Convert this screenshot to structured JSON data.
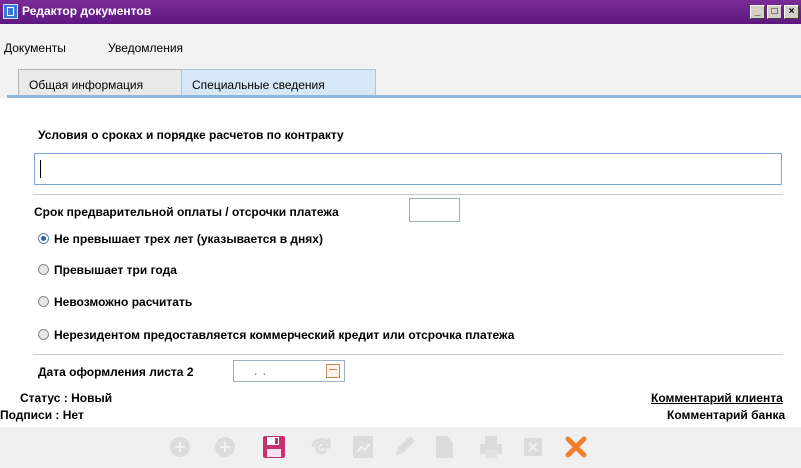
{
  "window": {
    "title": "Редактор документов"
  },
  "menu": {
    "items": [
      "Документы",
      "Уведомления"
    ]
  },
  "tabs": [
    "Общая информация",
    "Специальные сведения"
  ],
  "form": {
    "section_title": "Условия о сроках и порядке расчетов по контракту",
    "contract_terms_value": "",
    "prepayment_label": "Срок предварительной оплаты / отсрочки платежа",
    "prepayment_value": "",
    "options": [
      {
        "label": "Не превышает трех лет (указывается в днях)",
        "selected": true
      },
      {
        "label": "Превышает три года",
        "selected": false
      },
      {
        "label": "Невозможно расчитать",
        "selected": false
      },
      {
        "label": "Нерезидентом предоставляется коммерческий кредит или отсрочка платежа",
        "selected": false
      }
    ],
    "date_label": "Дата оформления листа 2",
    "date_value": ". ."
  },
  "status": {
    "status_label": "Статус :",
    "status_value": "Новый",
    "signatures_label": "Подписи :",
    "signatures_value": "Нет",
    "client_comment": "Комментарий клиента",
    "bank_comment": "Комментарий банка"
  },
  "toolbar": {
    "icons": [
      "add-icon",
      "add-icon",
      "save-icon",
      "refresh-icon",
      "report-icon",
      "edit-icon",
      "document-icon",
      "print-icon",
      "delete-icon",
      "close-icon"
    ],
    "enabled": [
      "save-icon",
      "close-icon"
    ],
    "accent_close": "#f08030",
    "accent_save": "#c83070"
  }
}
